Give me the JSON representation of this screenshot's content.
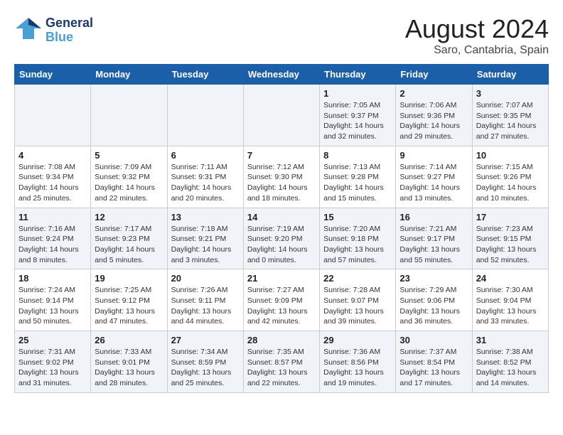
{
  "header": {
    "logo_general": "General",
    "logo_blue": "Blue",
    "month": "August 2024",
    "location": "Saro, Cantabria, Spain"
  },
  "days_of_week": [
    "Sunday",
    "Monday",
    "Tuesday",
    "Wednesday",
    "Thursday",
    "Friday",
    "Saturday"
  ],
  "weeks": [
    [
      {
        "day": "",
        "info": ""
      },
      {
        "day": "",
        "info": ""
      },
      {
        "day": "",
        "info": ""
      },
      {
        "day": "",
        "info": ""
      },
      {
        "day": "1",
        "info": "Sunrise: 7:05 AM\nSunset: 9:37 PM\nDaylight: 14 hours\nand 32 minutes."
      },
      {
        "day": "2",
        "info": "Sunrise: 7:06 AM\nSunset: 9:36 PM\nDaylight: 14 hours\nand 29 minutes."
      },
      {
        "day": "3",
        "info": "Sunrise: 7:07 AM\nSunset: 9:35 PM\nDaylight: 14 hours\nand 27 minutes."
      }
    ],
    [
      {
        "day": "4",
        "info": "Sunrise: 7:08 AM\nSunset: 9:34 PM\nDaylight: 14 hours\nand 25 minutes."
      },
      {
        "day": "5",
        "info": "Sunrise: 7:09 AM\nSunset: 9:32 PM\nDaylight: 14 hours\nand 22 minutes."
      },
      {
        "day": "6",
        "info": "Sunrise: 7:11 AM\nSunset: 9:31 PM\nDaylight: 14 hours\nand 20 minutes."
      },
      {
        "day": "7",
        "info": "Sunrise: 7:12 AM\nSunset: 9:30 PM\nDaylight: 14 hours\nand 18 minutes."
      },
      {
        "day": "8",
        "info": "Sunrise: 7:13 AM\nSunset: 9:28 PM\nDaylight: 14 hours\nand 15 minutes."
      },
      {
        "day": "9",
        "info": "Sunrise: 7:14 AM\nSunset: 9:27 PM\nDaylight: 14 hours\nand 13 minutes."
      },
      {
        "day": "10",
        "info": "Sunrise: 7:15 AM\nSunset: 9:26 PM\nDaylight: 14 hours\nand 10 minutes."
      }
    ],
    [
      {
        "day": "11",
        "info": "Sunrise: 7:16 AM\nSunset: 9:24 PM\nDaylight: 14 hours\nand 8 minutes."
      },
      {
        "day": "12",
        "info": "Sunrise: 7:17 AM\nSunset: 9:23 PM\nDaylight: 14 hours\nand 5 minutes."
      },
      {
        "day": "13",
        "info": "Sunrise: 7:18 AM\nSunset: 9:21 PM\nDaylight: 14 hours\nand 3 minutes."
      },
      {
        "day": "14",
        "info": "Sunrise: 7:19 AM\nSunset: 9:20 PM\nDaylight: 14 hours\nand 0 minutes."
      },
      {
        "day": "15",
        "info": "Sunrise: 7:20 AM\nSunset: 9:18 PM\nDaylight: 13 hours\nand 57 minutes."
      },
      {
        "day": "16",
        "info": "Sunrise: 7:21 AM\nSunset: 9:17 PM\nDaylight: 13 hours\nand 55 minutes."
      },
      {
        "day": "17",
        "info": "Sunrise: 7:23 AM\nSunset: 9:15 PM\nDaylight: 13 hours\nand 52 minutes."
      }
    ],
    [
      {
        "day": "18",
        "info": "Sunrise: 7:24 AM\nSunset: 9:14 PM\nDaylight: 13 hours\nand 50 minutes."
      },
      {
        "day": "19",
        "info": "Sunrise: 7:25 AM\nSunset: 9:12 PM\nDaylight: 13 hours\nand 47 minutes."
      },
      {
        "day": "20",
        "info": "Sunrise: 7:26 AM\nSunset: 9:11 PM\nDaylight: 13 hours\nand 44 minutes."
      },
      {
        "day": "21",
        "info": "Sunrise: 7:27 AM\nSunset: 9:09 PM\nDaylight: 13 hours\nand 42 minutes."
      },
      {
        "day": "22",
        "info": "Sunrise: 7:28 AM\nSunset: 9:07 PM\nDaylight: 13 hours\nand 39 minutes."
      },
      {
        "day": "23",
        "info": "Sunrise: 7:29 AM\nSunset: 9:06 PM\nDaylight: 13 hours\nand 36 minutes."
      },
      {
        "day": "24",
        "info": "Sunrise: 7:30 AM\nSunset: 9:04 PM\nDaylight: 13 hours\nand 33 minutes."
      }
    ],
    [
      {
        "day": "25",
        "info": "Sunrise: 7:31 AM\nSunset: 9:02 PM\nDaylight: 13 hours\nand 31 minutes."
      },
      {
        "day": "26",
        "info": "Sunrise: 7:33 AM\nSunset: 9:01 PM\nDaylight: 13 hours\nand 28 minutes."
      },
      {
        "day": "27",
        "info": "Sunrise: 7:34 AM\nSunset: 8:59 PM\nDaylight: 13 hours\nand 25 minutes."
      },
      {
        "day": "28",
        "info": "Sunrise: 7:35 AM\nSunset: 8:57 PM\nDaylight: 13 hours\nand 22 minutes."
      },
      {
        "day": "29",
        "info": "Sunrise: 7:36 AM\nSunset: 8:56 PM\nDaylight: 13 hours\nand 19 minutes."
      },
      {
        "day": "30",
        "info": "Sunrise: 7:37 AM\nSunset: 8:54 PM\nDaylight: 13 hours\nand 17 minutes."
      },
      {
        "day": "31",
        "info": "Sunrise: 7:38 AM\nSunset: 8:52 PM\nDaylight: 13 hours\nand 14 minutes."
      }
    ]
  ]
}
